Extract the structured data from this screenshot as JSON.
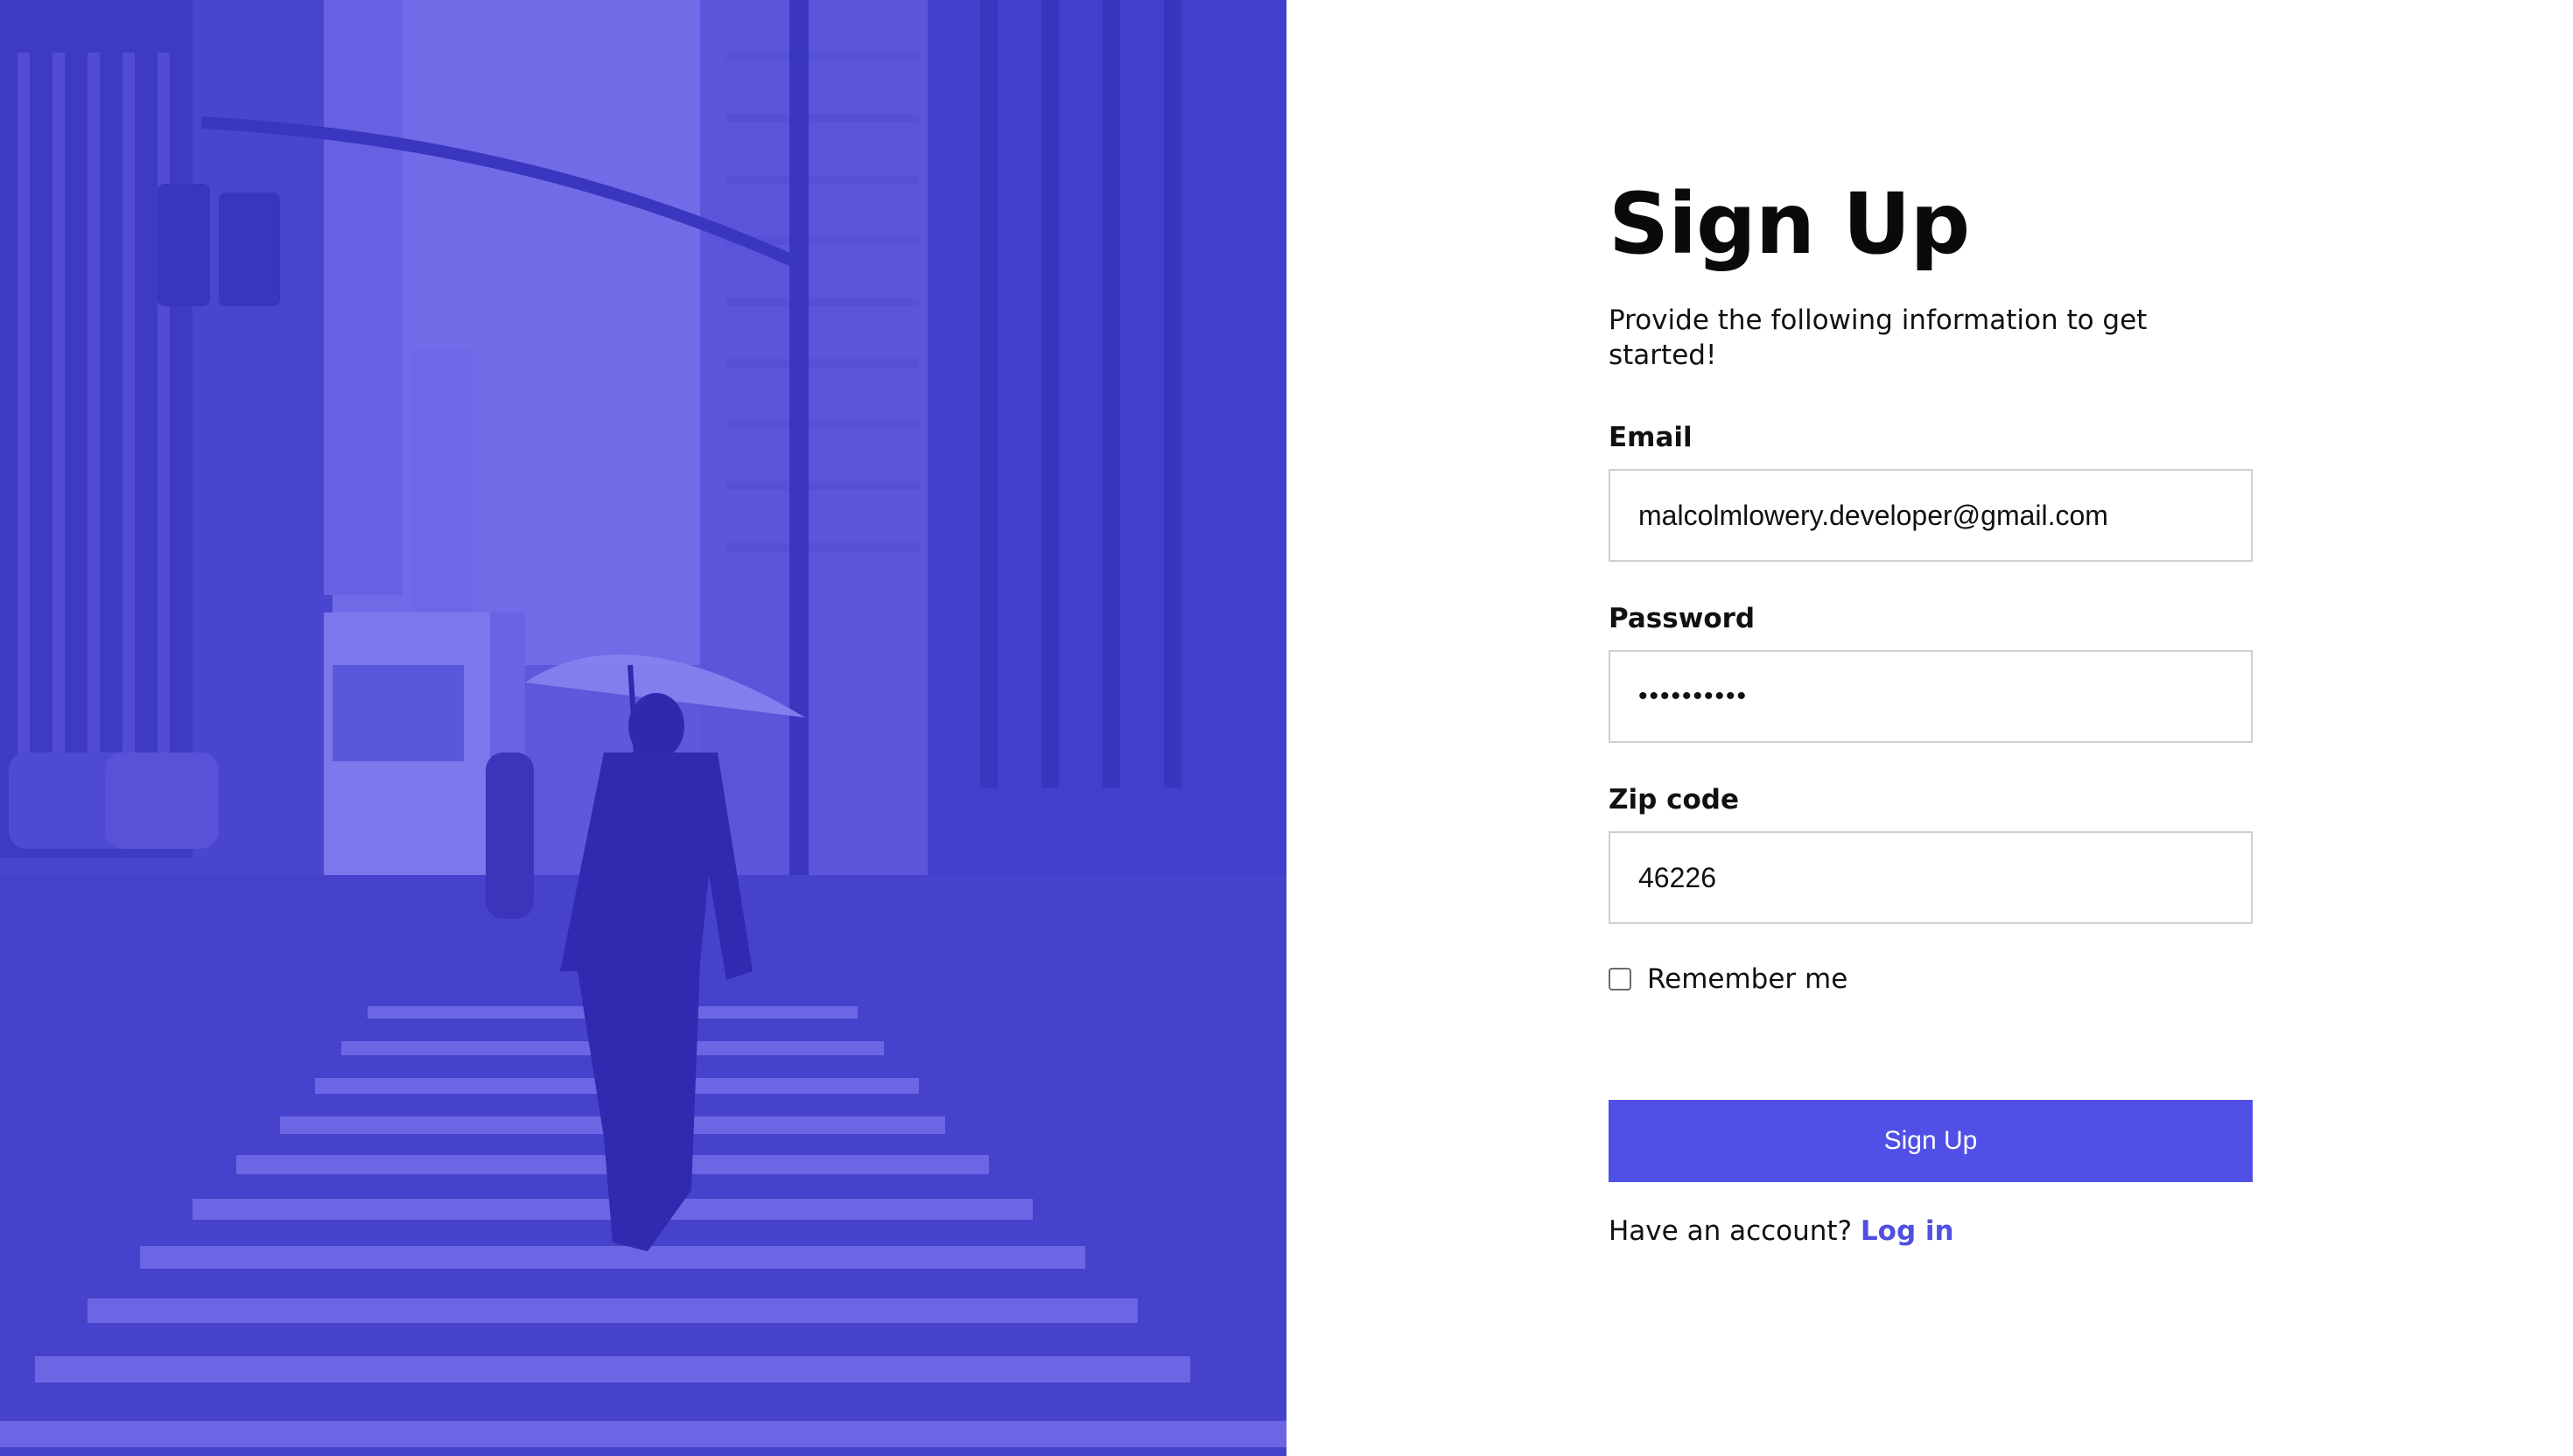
{
  "hero": {
    "icon": "city-street-photo",
    "tint_color": "#5150e6"
  },
  "form": {
    "title": "Sign Up",
    "subtitle": "Provide the following information to get started!",
    "email": {
      "label": "Email",
      "value": "malcolmlowery.developer@gmail.com"
    },
    "password": {
      "label": "Password",
      "value": "1234567890"
    },
    "zip": {
      "label": "Zip code",
      "value": "46226"
    },
    "remember": {
      "label": "Remember me",
      "checked": false
    },
    "submit_label": "Sign Up",
    "footer": {
      "prompt": "Have an account?",
      "link_label": "Log in"
    }
  },
  "colors": {
    "accent": "#5150e6",
    "link": "#4f4fe0",
    "input_border": "#cfcfcf"
  }
}
